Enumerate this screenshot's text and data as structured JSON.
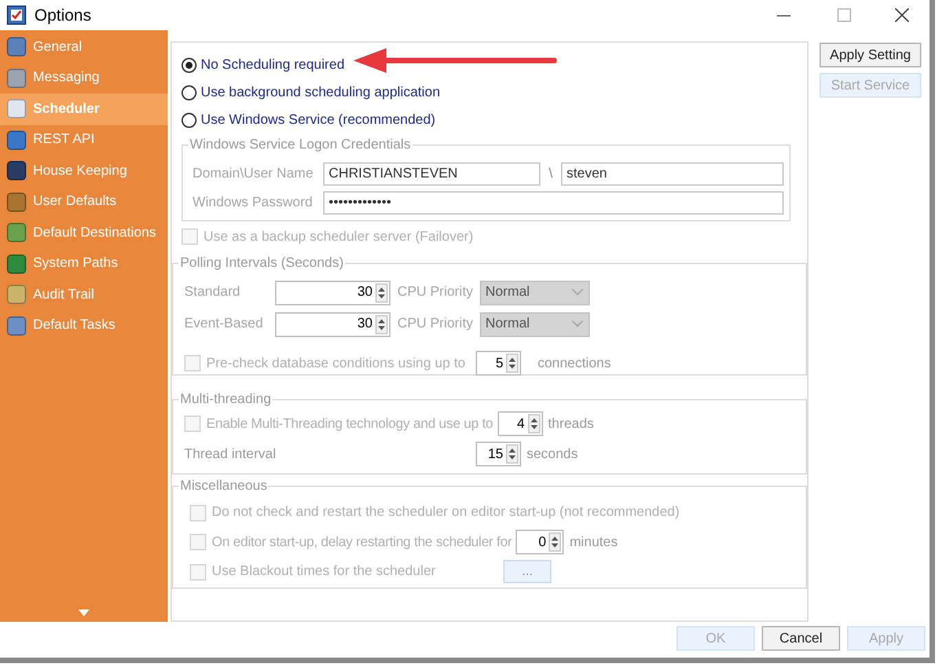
{
  "window": {
    "title": "Options"
  },
  "sidebar": {
    "items": [
      {
        "label": "General",
        "selected": false
      },
      {
        "label": "Messaging",
        "selected": false
      },
      {
        "label": "Scheduler",
        "selected": true
      },
      {
        "label": "REST API",
        "selected": false
      },
      {
        "label": "House Keeping",
        "selected": false
      },
      {
        "label": "User Defaults",
        "selected": false
      },
      {
        "label": "Default Destinations",
        "selected": false
      },
      {
        "label": "System Paths",
        "selected": false
      },
      {
        "label": "Audit Trail",
        "selected": false
      },
      {
        "label": "Default Tasks",
        "selected": false
      }
    ]
  },
  "scheduling_modes": [
    {
      "label": "No Scheduling required",
      "selected": true
    },
    {
      "label": "Use background scheduling application",
      "selected": false
    },
    {
      "label": "Use Windows Service (recommended)",
      "selected": false
    }
  ],
  "credentials": {
    "title": "Windows Service Logon Credentials",
    "domain_label": "Domain\\User Name",
    "domain": "CHRISTIANSTEVEN",
    "separator": "\\",
    "user": "steven",
    "password_label": "Windows Password",
    "password": "•••••••••••••"
  },
  "failover": {
    "label": "Use as a backup scheduler server (Failover)",
    "checked": false,
    "disabled": true
  },
  "polling": {
    "title": "Polling Intervals (Seconds)",
    "rows": [
      {
        "label": "Standard",
        "value": "30",
        "priority_label": "CPU Priority",
        "priority": "Normal"
      },
      {
        "label": "Event-Based",
        "value": "30",
        "priority_label": "CPU Priority",
        "priority": "Normal"
      }
    ],
    "precheck": {
      "label": "Pre-check database conditions using up to",
      "checked": false,
      "disabled": true,
      "value": "5",
      "unit": "connections"
    }
  },
  "multithreading": {
    "title": "Multi-threading",
    "enable": {
      "label": "Enable Multi-Threading technology and use up to",
      "checked": false,
      "disabled": true,
      "value": "4",
      "unit": "threads"
    },
    "interval": {
      "label": "Thread interval",
      "value": "15",
      "unit": "seconds"
    }
  },
  "misc": {
    "title": "Miscellaneous",
    "items": [
      {
        "kind": "check",
        "label": "Do not check and restart the scheduler on editor start-up (not recommended)",
        "checked": false,
        "disabled": true
      },
      {
        "kind": "spin",
        "label": "On editor start-up, delay restarting the scheduler for",
        "checked": false,
        "disabled": true,
        "value": "0",
        "unit": "minutes"
      },
      {
        "kind": "browse",
        "label": "Use Blackout times for the scheduler",
        "checked": false,
        "disabled": true,
        "button": "..."
      }
    ]
  },
  "side_buttons": [
    {
      "label": "Apply Setting",
      "disabled": false
    },
    {
      "label": "Start Service",
      "disabled": true
    }
  ],
  "buttons": [
    {
      "label": "OK",
      "disabled": true
    },
    {
      "label": "Cancel",
      "disabled": false
    },
    {
      "label": "Apply",
      "disabled": true
    }
  ]
}
